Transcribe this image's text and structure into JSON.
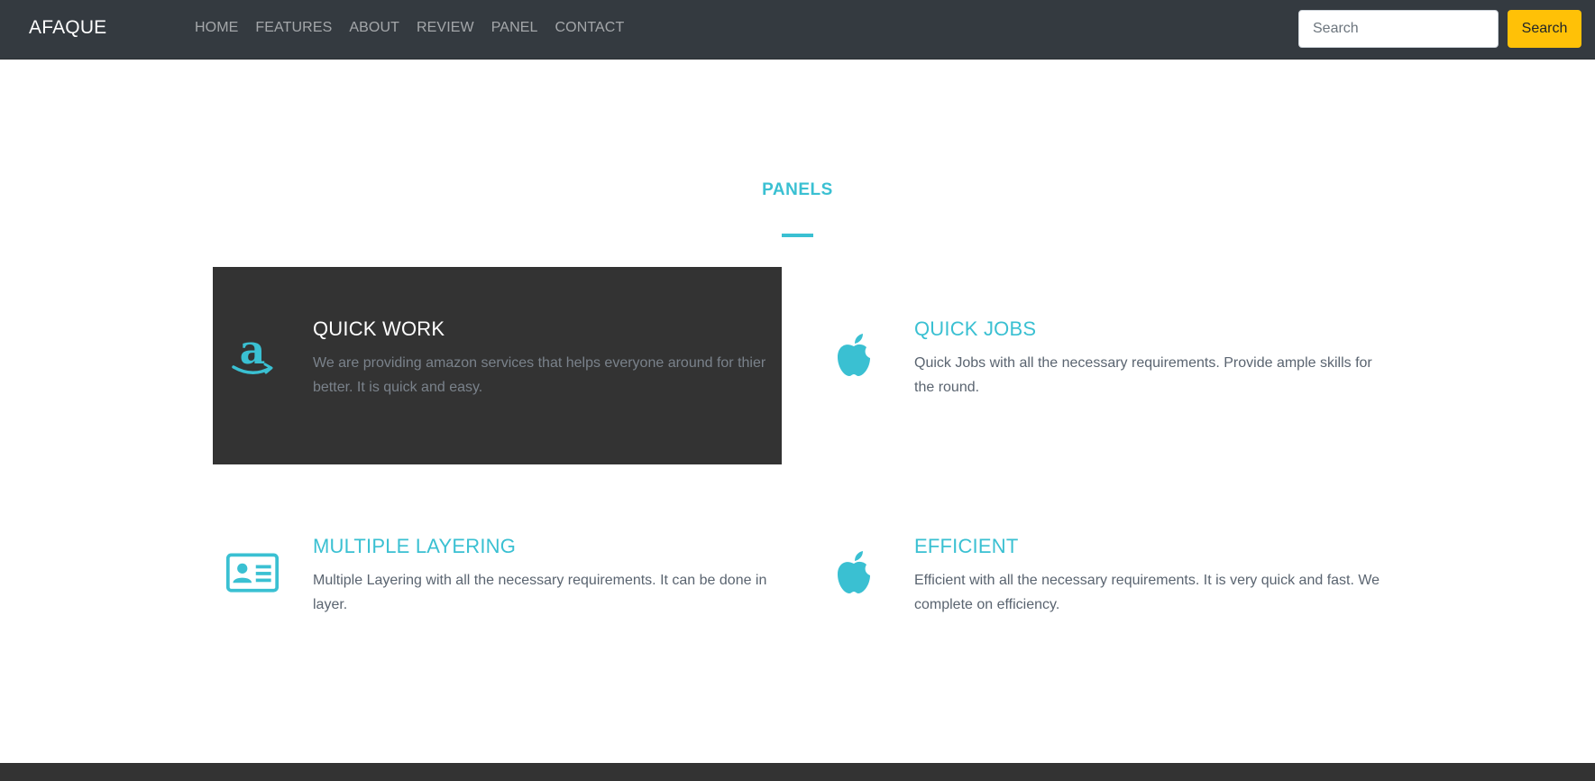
{
  "navbar": {
    "brand": "AFAQUE",
    "links": [
      "HOME",
      "FEATURES",
      "ABOUT",
      "REVIEW",
      "PANEL",
      "CONTACT"
    ],
    "search_placeholder": "Search",
    "search_button": "Search"
  },
  "section": {
    "title": "PANELS"
  },
  "panels": [
    {
      "icon": "amazon-icon",
      "title": "QUICK WORK",
      "description": "We are providing amazon services that helps everyone around for thier better. It is quick and easy.",
      "active": true
    },
    {
      "icon": "apple-icon",
      "title": "QUICK JOBS",
      "description": "Quick Jobs with all the necessary requirements. Provide ample skills for the round.",
      "active": false
    },
    {
      "icon": "id-card-icon",
      "title": "MULTIPLE LAYERING",
      "description": "Multiple Layering with all the necessary requirements. It can be done in layer.",
      "active": false
    },
    {
      "icon": "apple-icon",
      "title": "EFFICIENT",
      "description": "Efficient with all the necessary requirements. It is very quick and fast. We complete on efficiency.",
      "active": false
    }
  ],
  "colors": {
    "accent": "#3ac0d2",
    "navbar": "#343a40",
    "panel_active": "#333333",
    "search_button": "#ffc107"
  }
}
